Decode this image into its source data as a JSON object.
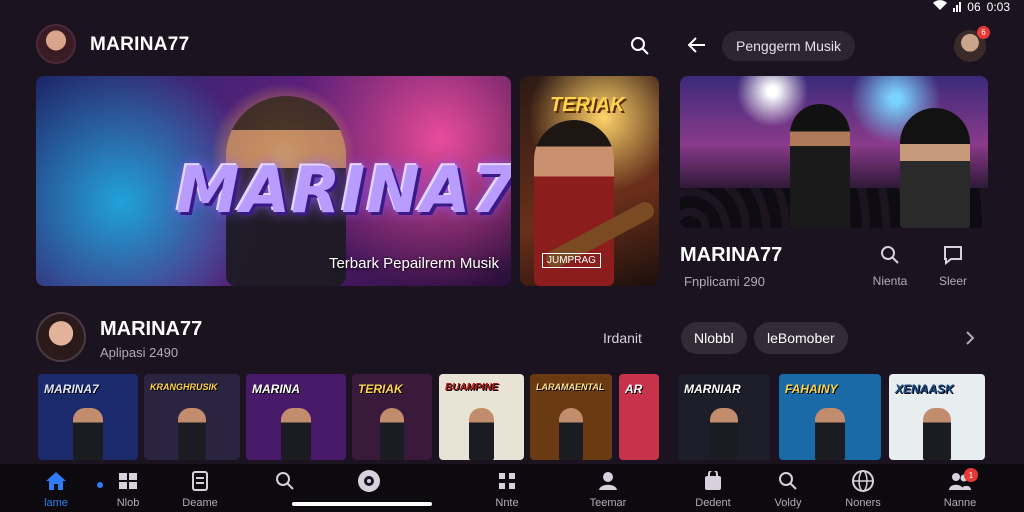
{
  "status_bar": {
    "time": "0:03",
    "indicator": "06"
  },
  "header": {
    "brand": "MARINA77",
    "search_icon": "search-icon"
  },
  "right_header": {
    "pill_title": "Penggerm Musik",
    "notification_count": "6"
  },
  "hero": {
    "logo_text": "MARINA7",
    "caption": "Terbark Pepailrerm Musik",
    "side_title": "TERIAK",
    "side_tag": "JUMPRAG"
  },
  "right_panel": {
    "title": "MARINA77",
    "subtitle": "Fnplicami 290",
    "actions": [
      {
        "label": "Nienta",
        "icon": "search-icon"
      },
      {
        "label": "Sleer",
        "icon": "chat-icon"
      }
    ]
  },
  "row2": {
    "title": "MARINA77",
    "subtitle": "Aplipasi 2490",
    "label": "Irdanit",
    "chips": [
      "Nlobbl",
      "leBomober"
    ]
  },
  "thumbnails": [
    {
      "title": "MARINA7",
      "bg": "#1a2a6a"
    },
    {
      "title": "KRANGHRUSIK",
      "bg": "#2a2440"
    },
    {
      "title": "MARINA",
      "bg": "#4a1a6a"
    },
    {
      "title": "TERIAK",
      "bg": "#3a1a3a"
    },
    {
      "title": "BUAMPINE",
      "bg": "#e9e3d6"
    },
    {
      "title": "LARAMAENTAL",
      "bg": "#6a3a12"
    },
    {
      "title": "AR",
      "bg": "#c8324a"
    },
    {
      "title": "MARNIAR",
      "bg": "#1e1e2a"
    },
    {
      "title": "FAHAINY",
      "bg": "#1a6aa8"
    },
    {
      "title": "XENAASK",
      "bg": "#e8eef0"
    }
  ],
  "bottom_nav": [
    {
      "label": "lame",
      "icon": "home-icon",
      "active": true
    },
    {
      "label": "Nlob",
      "icon": "grid-icon",
      "active": false
    },
    {
      "label": "Deame",
      "icon": "document-icon",
      "active": false
    },
    {
      "label": "",
      "icon": "search-icon",
      "active": false
    },
    {
      "label": "",
      "icon": "disc-icon",
      "active": false
    },
    {
      "label": "Nnte",
      "icon": "apps-icon",
      "active": false
    },
    {
      "label": "Teemar",
      "icon": "user-icon",
      "active": false
    },
    {
      "label": "Dedent",
      "icon": "bag-icon",
      "active": false
    },
    {
      "label": "Voldy",
      "icon": "search-icon",
      "active": false
    },
    {
      "label": "Noners",
      "icon": "globe-icon",
      "active": false
    },
    {
      "label": "Nanne",
      "icon": "people-icon",
      "active": false
    }
  ],
  "nav_badge": "1",
  "colors": {
    "background": "#1b1420",
    "accent": "#2f7df6",
    "badge": "#e53935",
    "muted_text": "#b3aab8"
  }
}
